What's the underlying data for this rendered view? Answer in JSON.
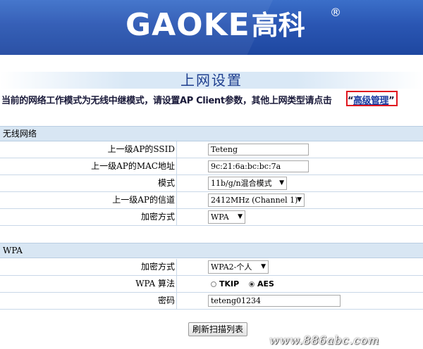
{
  "brand": {
    "latin": "GAOKE",
    "cjk": "高科",
    "reg": "®"
  },
  "page_title": "上网设置",
  "notice": {
    "text": "当前的网络工作模式为无线中继模式，请设置AP Client参数，其他上网类型请点击",
    "link_quote_open": "“",
    "link_label": "高级管理",
    "link_quote_close": "”"
  },
  "wireless": {
    "header": "无线网络",
    "rows": [
      {
        "label": "上一级AP的SSID",
        "value": "Teteng"
      },
      {
        "label": "上一级AP的MAC地址",
        "value": "9c:21:6a:bc:bc:7a"
      },
      {
        "label": "模式",
        "value": "11b/g/n混合模式"
      },
      {
        "label": "上一级AP的信道",
        "value": "2412MHz (Channel 1)"
      },
      {
        "label": "加密方式",
        "value": "WPA"
      }
    ]
  },
  "wpa": {
    "header": "WPA",
    "encryption_label": "加密方式",
    "encryption_value": "WPA2-个人",
    "algorithm_label": "WPA 算法",
    "algorithm_options": [
      "TKIP",
      "AES"
    ],
    "algorithm_selected": "AES",
    "password_label": "密码",
    "password_value": "teteng01234"
  },
  "refresh_button": "刷新扫描列表",
  "watermark": "www.886abc.com"
}
